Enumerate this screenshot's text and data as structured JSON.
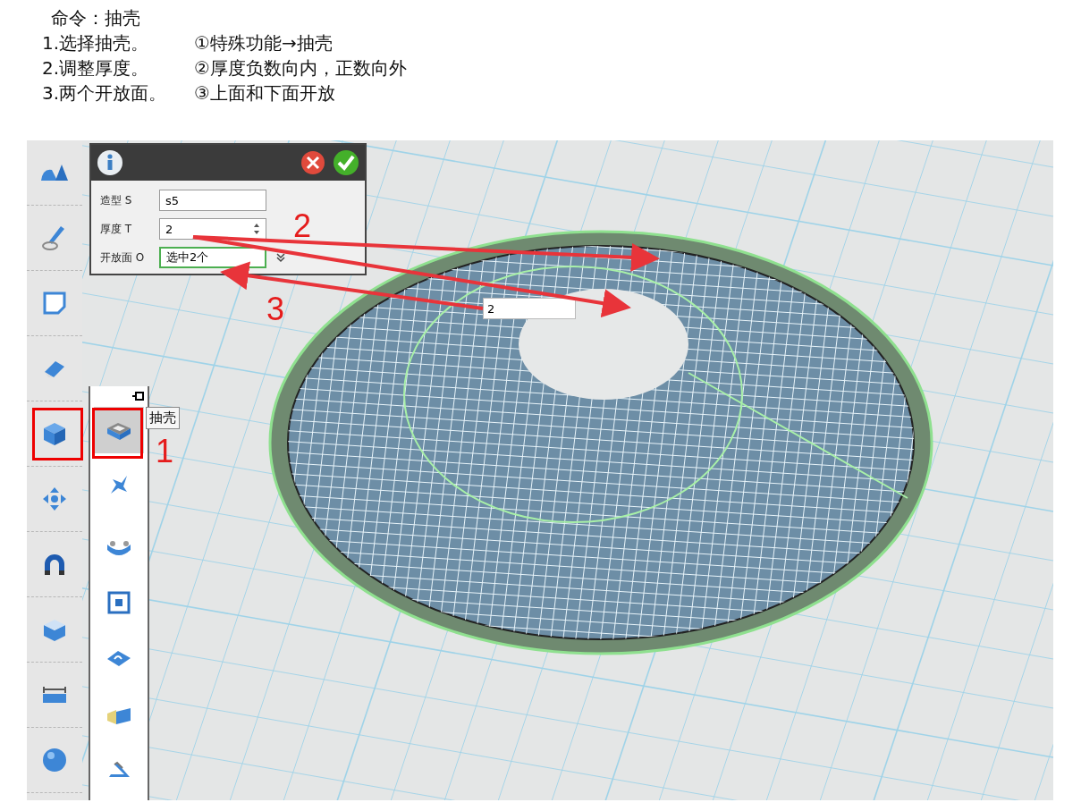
{
  "instructions": {
    "title": "命令：抽壳",
    "steps": [
      {
        "action": "1.选择抽壳。",
        "note": "①特殊功能→抽壳"
      },
      {
        "action": "2.调整厚度。",
        "note": "②厚度负数向内，正数向外"
      },
      {
        "action": "3.两个开放面。",
        "note": "③上面和下面开放"
      }
    ]
  },
  "shell_panel": {
    "items": [
      {
        "selected": true
      },
      {
        "selected": false
      },
      {
        "selected": false
      },
      {
        "selected": false
      },
      {
        "selected": false
      },
      {
        "selected": false
      },
      {
        "selected": false
      }
    ],
    "tooltip": "抽壳"
  },
  "dialog": {
    "fields": [
      {
        "kind": "text",
        "label": "造型 S",
        "value": "s5",
        "highlighted": false
      },
      {
        "kind": "spinner",
        "label": "厚度 T",
        "value": "2",
        "highlighted": false
      },
      {
        "kind": "select",
        "label": "开放面 O",
        "value": "选中2个",
        "highlighted": true
      }
    ]
  },
  "canvas_input": {
    "value": "2"
  },
  "markers": [
    "1",
    "2",
    "3"
  ]
}
